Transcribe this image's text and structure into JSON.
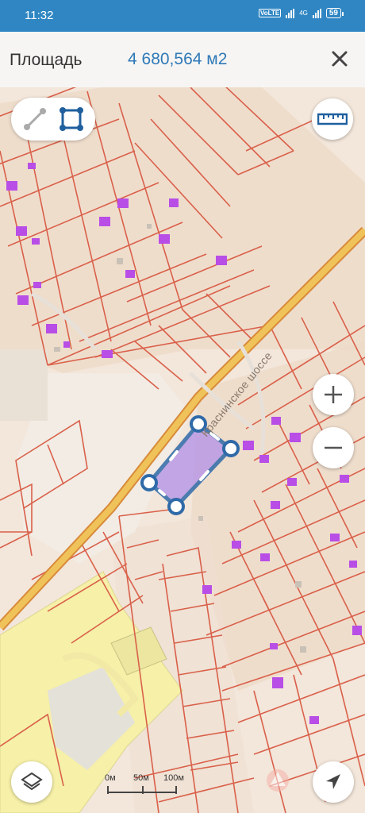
{
  "status_bar": {
    "time": "11:32",
    "volte": "VoLTE",
    "network_type": "4G",
    "battery": "59"
  },
  "header": {
    "label": "Площадь",
    "area_value": "4 680,564 м2",
    "close_icon": "close-icon"
  },
  "map": {
    "street_name": "Краснинское шоссе",
    "colors": {
      "background": "#f3e6da",
      "parcel_border": "#d9604a",
      "road": "#e6b04a",
      "building": "#b84ee6",
      "industrial_zone": "#f6f0a8",
      "polygon_fill": "#b99ae6",
      "polygon_stroke": "#2f6aa8"
    }
  },
  "controls": {
    "line_mode_icon": "line-measure-icon",
    "area_mode_icon": "area-measure-icon",
    "ruler_icon": "ruler-icon",
    "zoom_in_icon": "plus-icon",
    "zoom_out_icon": "minus-icon",
    "layers_icon": "layers-icon",
    "locate_icon": "navigation-arrow-icon"
  },
  "scale": {
    "labels": [
      "0м",
      "50м",
      "100м"
    ]
  }
}
